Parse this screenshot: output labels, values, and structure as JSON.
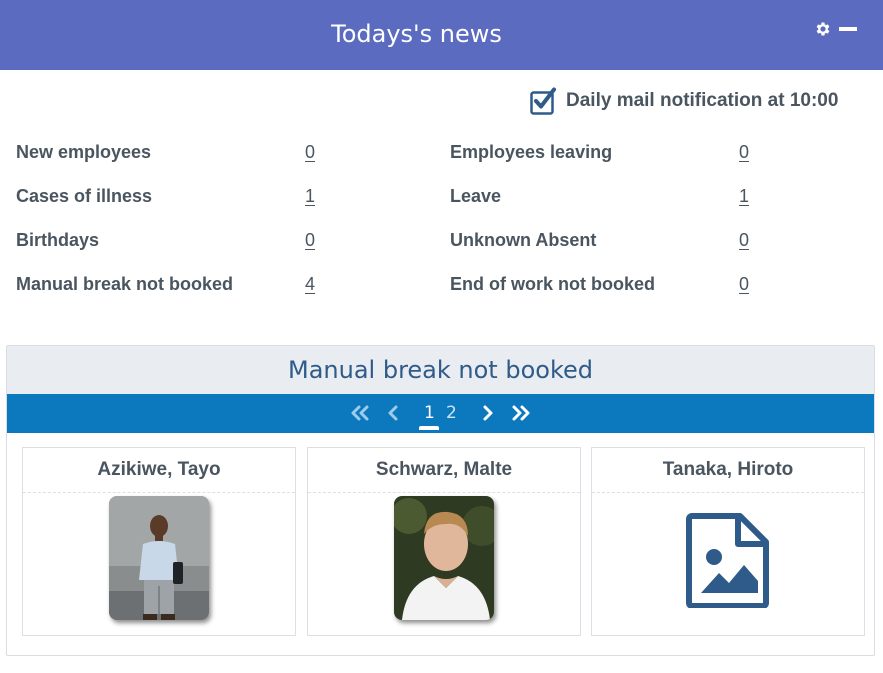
{
  "header": {
    "title": "Todays's news",
    "settings_icon": "gear-icon",
    "minimize_icon": "minus-icon",
    "background": "#5b6bc0"
  },
  "notification": {
    "label": "Daily mail notification at 10:00",
    "checked": true
  },
  "stats": {
    "left": [
      {
        "label": "New employees",
        "value": "0"
      },
      {
        "label": "Cases of illness",
        "value": "1"
      },
      {
        "label": "Birthdays",
        "value": "0"
      },
      {
        "label": "Manual break not booked",
        "value": "4"
      }
    ],
    "right": [
      {
        "label": "Employees leaving",
        "value": "0"
      },
      {
        "label": "Leave",
        "value": "1"
      },
      {
        "label": "Unknown Absent",
        "value": "0"
      },
      {
        "label": "End of work not booked",
        "value": "0"
      }
    ]
  },
  "panel": {
    "title": "Manual break not booked",
    "pager": {
      "pages": [
        "1",
        "2"
      ],
      "current": "1",
      "icons": [
        "double-chevron-left-icon",
        "chevron-left-icon",
        "chevron-right-icon",
        "double-chevron-right-icon"
      ],
      "background": "#0c79bf"
    },
    "cards": [
      {
        "name": "Azikiwe, Tayo",
        "photo": "person-photo"
      },
      {
        "name": "Schwarz, Malte",
        "photo": "person-photo"
      },
      {
        "name": "Tanaka, Hiroto",
        "photo": "image-file-icon"
      }
    ]
  }
}
